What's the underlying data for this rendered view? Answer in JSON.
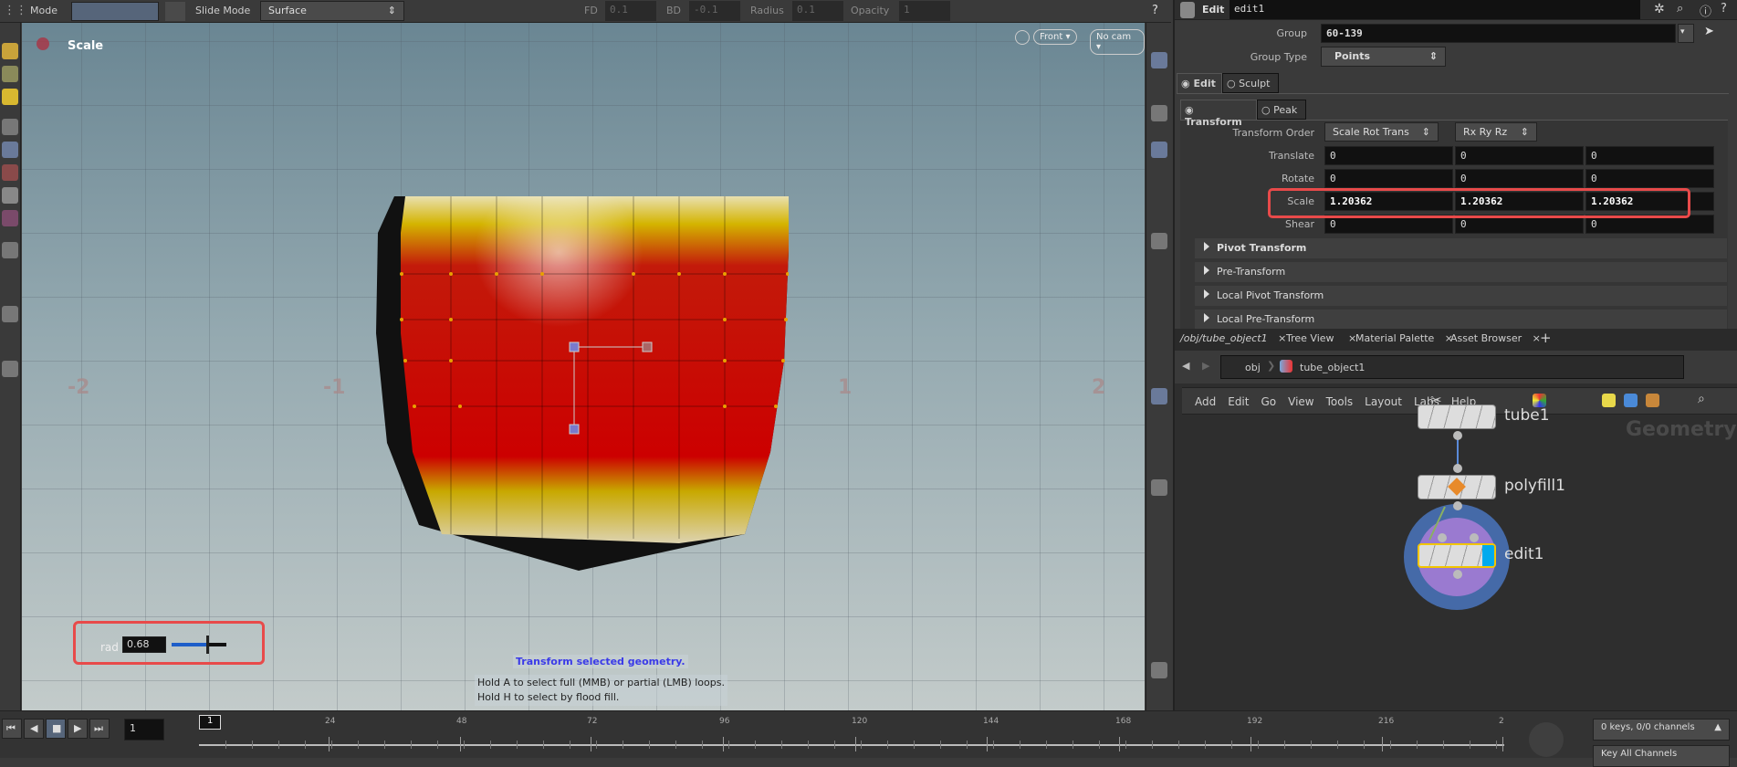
{
  "toolbar": {
    "mode_label": "Mode",
    "slide_mode_label": "Slide Mode",
    "slide_mode_value": "Surface",
    "fd_label": "FD",
    "fd_value": "0.1",
    "bd_label": "BD",
    "bd_value": "-0.1",
    "radius_label": "Radius",
    "radius_value": "0.1",
    "opacity_label": "Opacity",
    "opacity_value": "1"
  },
  "viewport": {
    "tool_name": "Scale",
    "view_menu": "Front",
    "cam_menu": "No cam",
    "axis_labels": [
      "-2",
      "-1",
      "1",
      "2"
    ],
    "rad_label": "rad",
    "rad_value": "0.68",
    "rad_slider_fraction": 0.68,
    "tooltip_title": "Transform selected geometry.",
    "tooltip_lines": [
      "Hold A to select full (MMB) or partial (LMB) loops.",
      "Hold H to select by flood fill."
    ]
  },
  "params": {
    "node_type": "Edit",
    "node_name": "edit1",
    "group_label": "Group",
    "group_value": "60-139",
    "group_type_label": "Group Type",
    "group_type_value": "Points",
    "mode_tabs": [
      "Edit",
      "Sculpt"
    ],
    "sub_tabs": [
      "Transform",
      "Peak"
    ],
    "transform_order_label": "Transform Order",
    "transform_order_value": "Scale Rot Trans",
    "rot_order_value": "Rx Ry Rz",
    "rows": [
      {
        "label": "Translate",
        "values": [
          "0",
          "0",
          "0"
        ]
      },
      {
        "label": "Rotate",
        "values": [
          "0",
          "0",
          "0"
        ]
      },
      {
        "label": "Scale",
        "values": [
          "1.20362",
          "1.20362",
          "1.20362"
        ]
      },
      {
        "label": "Shear",
        "values": [
          "0",
          "0",
          "0"
        ]
      }
    ],
    "sections": [
      "Pivot Transform",
      "Pre-Transform",
      "Local Pivot Transform",
      "Local Pre-Transform"
    ]
  },
  "network": {
    "tabs": [
      "/obj/tube_object1",
      "Tree View",
      "Material Palette",
      "Asset Browser"
    ],
    "path": [
      "obj",
      "tube_object1"
    ],
    "menu": [
      "Add",
      "Edit",
      "Go",
      "View",
      "Tools",
      "Layout",
      "Labs",
      "Help"
    ],
    "context_label": "Geometry",
    "nodes": [
      "tube1",
      "polyfill1",
      "edit1"
    ]
  },
  "timeline": {
    "current_frame": "1",
    "frame_marker": "1",
    "ticks": [
      "24",
      "48",
      "72",
      "96",
      "120",
      "144",
      "168",
      "192",
      "216",
      "2"
    ],
    "keys_status": "0 keys, 0/0 channels",
    "key_all": "Key All Channels"
  },
  "colors": {
    "accent_red": "#e84a4a",
    "selected_node": "#f2c500",
    "node_flag": "#00aaee",
    "tooltip_blue": "#3a3ae8"
  }
}
